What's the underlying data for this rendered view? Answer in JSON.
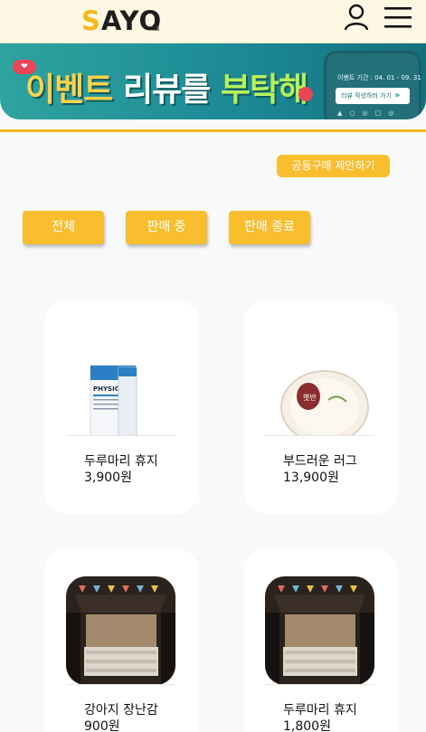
{
  "header": {
    "logo_highlight": "S",
    "logo_rest": "AYO",
    "user_icon": "user-icon",
    "menu_icon": "hamburger-menu-icon"
  },
  "banner": {
    "title_part1": "이벤트 ",
    "title_part2": "리뷰를 ",
    "title_part3": "부탁해",
    "period": "이벤트 기간 : 04. 01 - 09. 31",
    "cta": "리뷰 작성하러 가기"
  },
  "actions": {
    "propose_label": "공동구매 제안하기"
  },
  "filters": [
    {
      "label": "전체"
    },
    {
      "label": "판매 중"
    },
    {
      "label": "판매 종료"
    }
  ],
  "products": [
    {
      "name": "두루마리 휴지",
      "price": "3,900원",
      "image": "physiogel-product"
    },
    {
      "name": "부드러운 러그",
      "price": "13,900원",
      "image": "rice-bowl-product"
    },
    {
      "name": "강아지 장난감",
      "price": "900원",
      "image": "car-camping-mattress"
    },
    {
      "name": "두루마리 휴지",
      "price": "1,800원",
      "image": "car-camping-mattress"
    }
  ],
  "colors": {
    "accent": "#f8be2e",
    "header_bg": "#fdf8e4",
    "banner_bg": "#1c8a96",
    "page_bg": "#f7f9fb"
  }
}
